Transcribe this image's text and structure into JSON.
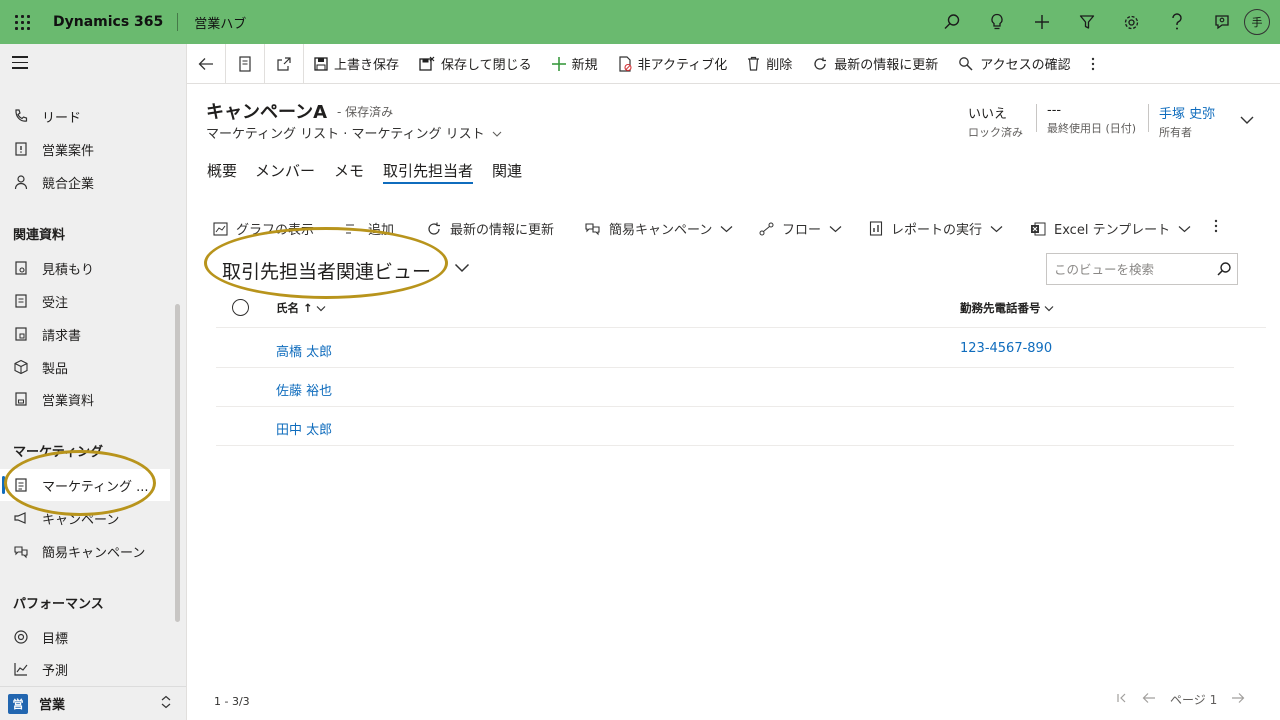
{
  "topbar": {
    "brand": "Dynamics 365",
    "app_name": "営業ハブ",
    "avatar_initial": "手",
    "icons": [
      "search-icon",
      "lightbulb-icon",
      "plus-icon",
      "filter-icon",
      "gear-icon",
      "help-icon",
      "chat-icon",
      "user-avatar"
    ]
  },
  "sidebar": {
    "sections": [
      {
        "items": [
          {
            "label": "リード",
            "icon": "phone-icon"
          },
          {
            "label": "営業案件",
            "icon": "opportunity-icon"
          },
          {
            "label": "競合企業",
            "icon": "person-icon"
          }
        ]
      },
      {
        "title": "関連資料",
        "items": [
          {
            "label": "見積もり",
            "icon": "quote-icon"
          },
          {
            "label": "受注",
            "icon": "order-icon"
          },
          {
            "label": "請求書",
            "icon": "invoice-icon"
          },
          {
            "label": "製品",
            "icon": "box-icon"
          },
          {
            "label": "営業資料",
            "icon": "document-icon"
          }
        ]
      },
      {
        "title": "マーケティング",
        "items": [
          {
            "label": "マーケティング ...",
            "icon": "list-icon",
            "active": true
          },
          {
            "label": "キャンペーン",
            "icon": "megaphone-icon"
          },
          {
            "label": "簡易キャンペーン",
            "icon": "quick-campaign-icon"
          }
        ]
      },
      {
        "title": "パフォーマンス",
        "items": [
          {
            "label": "目標",
            "icon": "target-icon"
          },
          {
            "label": "予測",
            "icon": "chart-icon"
          }
        ]
      }
    ],
    "area": {
      "badge": "営",
      "label": "営業"
    }
  },
  "commandbar": {
    "save": "上書き保存",
    "save_close": "保存して閉じる",
    "new": "新規",
    "deactivate": "非アクティブ化",
    "delete": "削除",
    "refresh": "最新の情報に更新",
    "check_access": "アクセスの確認"
  },
  "record": {
    "title": "キャンペーンA",
    "status": "- 保存済み",
    "subtitle": "マーケティング リスト · マーケティング リスト",
    "header_fields": [
      {
        "value": "いいえ",
        "label": "ロック済み"
      },
      {
        "value": "---",
        "label": "最終使用日 (日付)"
      },
      {
        "value": "手塚 史弥",
        "label": "所有者"
      }
    ]
  },
  "tabs": [
    "概要",
    "メンバー",
    "メモ",
    "取引先担当者",
    "関連"
  ],
  "active_tab": "取引先担当者",
  "subgrid": {
    "commands": {
      "show_chart": "グラフの表示",
      "add": "追加",
      "refresh": "最新の情報に更新",
      "quick_campaign": "簡易キャンペーン",
      "flow": "フロー",
      "run_report": "レポートの実行",
      "excel_templates": "Excel テンプレート"
    },
    "view_name": "取引先担当者関連ビュー",
    "search_placeholder": "このビューを検索",
    "columns": [
      "氏名 ↑",
      "勤務先電話番号"
    ],
    "rows": [
      {
        "name": "高橋 太郎",
        "phone": "123-4567-890"
      },
      {
        "name": "佐藤 裕也",
        "phone": ""
      },
      {
        "name": "田中 太郎",
        "phone": ""
      }
    ],
    "record_count": "1 - 3/3",
    "page_label": "ページ 1"
  }
}
